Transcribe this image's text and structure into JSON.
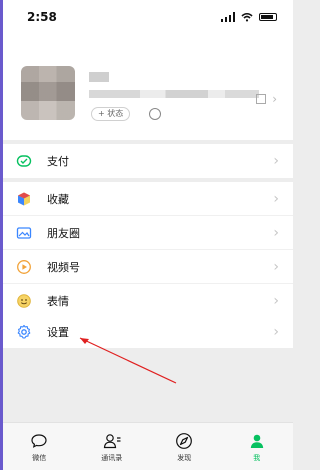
{
  "status_bar": {
    "time": "2:58"
  },
  "profile": {
    "status_label": "+ 状态"
  },
  "menu": {
    "pay": "支付",
    "favorites": "收藏",
    "moments": "朋友圈",
    "channels": "视频号",
    "stickers": "表情",
    "settings": "设置"
  },
  "tabbar": {
    "chats": "微信",
    "contacts": "通讯录",
    "discover": "发现",
    "me": "我"
  },
  "colors": {
    "accent": "#07c160",
    "annotation_arrow": "#e02020"
  }
}
